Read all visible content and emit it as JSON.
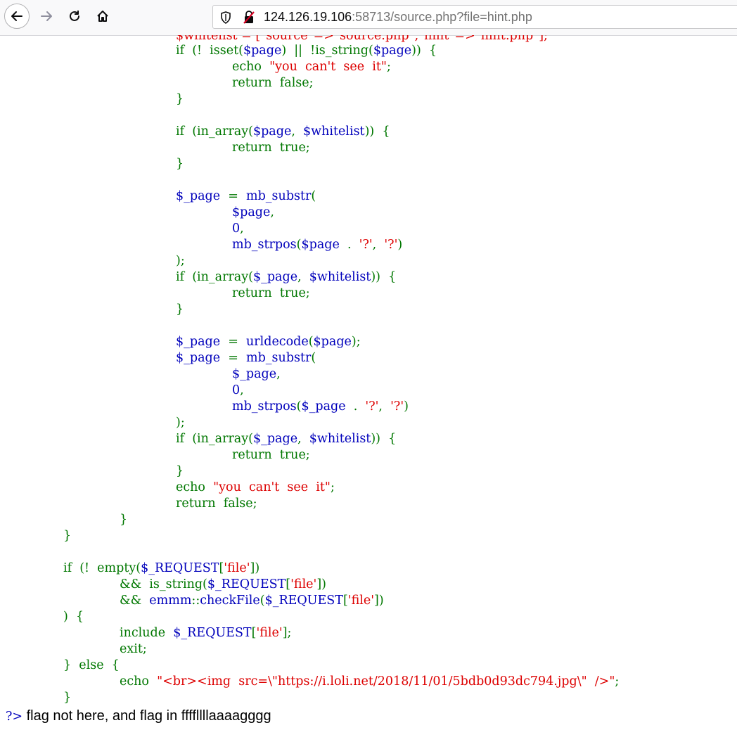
{
  "browser": {
    "url_host": "124.126.19.106",
    "url_rest": ":58713/source.php?file=hint.php"
  },
  "code": {
    "l00": "$whitelist = [\"source\"=>\"source.php\",\"hint\"=>\"hint.php\"];",
    "l01_k": "if  (!  isset(",
    "l01_v": "$page",
    "l01_k2": ")  ||  !is_string(",
    "l01_v2": "$page",
    "l01_k3": "))  {",
    "l02_k": "echo  ",
    "l02_s": "\"you  can't  see  it\"",
    "l02_k2": ";",
    "l03": "return  false;",
    "l04": "}",
    "l05_k": "if  (in_array(",
    "l05_v": "$page",
    "l05_k2": ",  ",
    "l05_v2": "$whitelist",
    "l05_k3": "))  {",
    "l06": "return  true;",
    "l07": "}",
    "l08_v": "$_page",
    "l08_k": "  =  ",
    "l08_v2": "mb_substr",
    "l08_k2": "(",
    "l09_v": "$page",
    "l09_k": ",",
    "l10_v": "0",
    "l10_k": ",",
    "l11_v": "mb_strpos",
    "l11_k": "(",
    "l11_v2": "$page",
    "l11_k2": "  .  ",
    "l11_s": "'?'",
    "l11_k3": ",  ",
    "l11_s2": "'?'",
    "l11_k4": ")",
    "l12": ");",
    "l13_k": "if  (in_array(",
    "l13_v": "$_page",
    "l13_k2": ",  ",
    "l13_v2": "$whitelist",
    "l13_k3": "))  {",
    "l14": "return  true;",
    "l15": "}",
    "l16_v": "$_page",
    "l16_k": "  =  ",
    "l16_v2": "urldecode",
    "l16_k2": "(",
    "l16_v3": "$page",
    "l16_k3": ");",
    "l17_v": "$_page",
    "l17_k": "  =  ",
    "l17_v2": "mb_substr",
    "l17_k2": "(",
    "l18_v": "$_page",
    "l18_k": ",",
    "l19_v": "0",
    "l19_k": ",",
    "l20_v": "mb_strpos",
    "l20_k": "(",
    "l20_v2": "$_page",
    "l20_k2": "  .  ",
    "l20_s": "'?'",
    "l20_k3": ",  ",
    "l20_s2": "'?'",
    "l20_k4": ")",
    "l21": ");",
    "l22_k": "if  (in_array(",
    "l22_v": "$_page",
    "l22_k2": ",  ",
    "l22_v2": "$whitelist",
    "l22_k3": "))  {",
    "l23": "return  true;",
    "l24": "}",
    "l25_k": "echo  ",
    "l25_s": "\"you  can't  see  it\"",
    "l25_k2": ";",
    "l26": "return  false;",
    "l27": "}",
    "l28": "}",
    "l29_k": "if  (!  empty(",
    "l29_v": "$_REQUEST",
    "l29_k2": "[",
    "l29_s": "'file'",
    "l29_k3": "])",
    "l30_k": "&&  is_string(",
    "l30_v": "$_REQUEST",
    "l30_k2": "[",
    "l30_s": "'file'",
    "l30_k3": "])",
    "l31_k": "&&  ",
    "l31_v": "emmm",
    "l31_k2": "::",
    "l31_v2": "checkFile",
    "l31_k3": "(",
    "l31_v3": "$_REQUEST",
    "l31_k4": "[",
    "l31_s": "'file'",
    "l31_k5": "])",
    "l32": ")  {",
    "l33_k": "include  ",
    "l33_v": "$_REQUEST",
    "l33_k2": "[",
    "l33_s": "'file'",
    "l33_k3": "];",
    "l34": "exit;",
    "l35": "}  else  {",
    "l36_k": "echo  ",
    "l36_s": "\"<br><img  src=\\\"https://i.loli.net/2018/11/01/5bdb0d93dc794.jpg\\\"  />\"",
    "l36_k2": ";",
    "l37": "}",
    "l38_q": "?>",
    "l38_text": " flag not here, and flag in ffffllllaaaagggg"
  }
}
